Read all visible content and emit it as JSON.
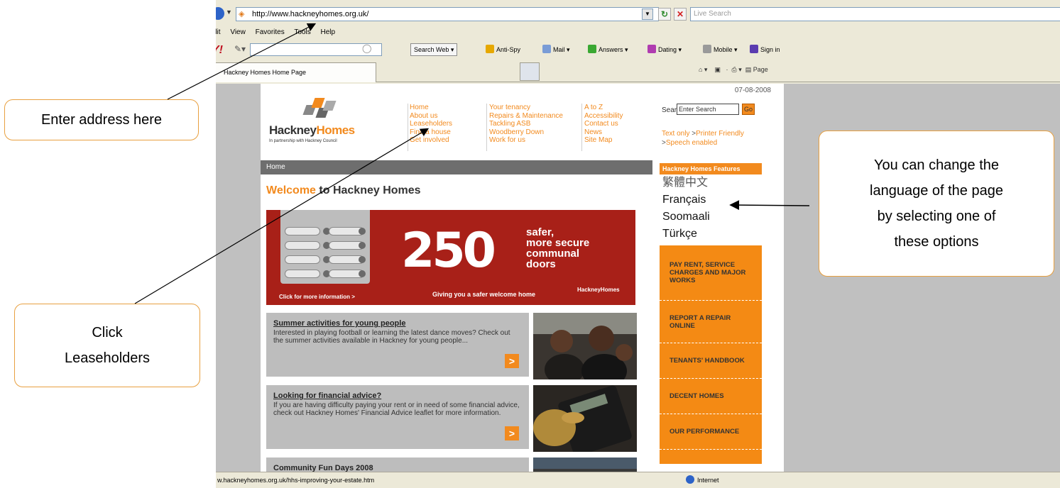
{
  "browser": {
    "address_url": "http://www.hackneyhomes.org.uk/",
    "live_search_placeholder": "Live Search",
    "menu": [
      "dit",
      "View",
      "Favorites",
      "Tools",
      "Help"
    ],
    "toolbar": {
      "search_web_label": "Search Web",
      "anti_spy_label": "Anti-Spy",
      "mail_label": "Mail",
      "answers_label": "Answers",
      "dating_label": "Dating",
      "mobile_label": "Mobile",
      "sign_in_label": "Sign in"
    },
    "tab_title": "Hackney Homes Home Page",
    "command_page_label": "Page",
    "status_url": "w.hackneyhomes.org.uk/hhs-improving-your-estate.htm",
    "status_zone": "Internet"
  },
  "site": {
    "date": "07-08-2008",
    "logo_name_part1": "Hackney",
    "logo_name_part2": "Homes",
    "logo_tagline": "In partnership with Hackney Council",
    "nav": [
      [
        "Home",
        "About us",
        "Leaseholders",
        "Find a house",
        "Get involved"
      ],
      [
        "Your tenancy",
        "Repairs & Maintenance",
        "Tackling ASB",
        "Woodberry Down",
        "Work for us"
      ],
      [
        "A to Z",
        "Accessibility",
        "Contact us",
        "News",
        "Site Map"
      ]
    ],
    "search_label": "Search:",
    "search_placeholder": "Enter Search",
    "search_go": "Go",
    "util_text_only": "Text only",
    "util_printer": "Printer Friendly",
    "util_speech": "Speech enabled",
    "breadcrumb": "Home",
    "welcome_part1": "Welcome",
    "welcome_part2": " to Hackney Homes",
    "banner": {
      "big_number": "250",
      "headline_lines": [
        "safer,",
        "more secure",
        "communal",
        "doors"
      ],
      "click_text": "Click for more information >",
      "tagline": "Giving you a safer welcome home",
      "logo_text": "HackneyHomes"
    },
    "news": [
      {
        "title": "Summer activities for young people",
        "body": "Interested in playing football or learning the latest dance moves? Check out the summer activities available in Hackney for young people..."
      },
      {
        "title": "Looking for financial advice?",
        "body": "If you are having difficulty paying your rent or in need of some financial advice, check out Hackney Homes' Financial Advice leaflet for more information."
      },
      {
        "title": "Community Fun Days 2008",
        "body": ""
      }
    ],
    "features_heading": "Hackney Homes Features",
    "languages": [
      "繁體中文",
      "Français",
      "Soomaali",
      "Türkçe"
    ],
    "orange_links": [
      "PAY RENT, SERVICE CHARGES AND MAJOR WORKS",
      "REPORT A REPAIR ONLINE",
      "TENANTS' HANDBOOK",
      "DECENT HOMES",
      "OUR PERFORMANCE"
    ]
  },
  "callouts": {
    "address": "Enter address here",
    "leaseholders_line1": "Click",
    "leaseholders_line2": "Leaseholders",
    "language_lines": [
      "You can change the",
      "language of the page",
      "by selecting one of",
      "these options"
    ]
  },
  "colors": {
    "brand_orange": "#f28a1e",
    "banner_red": "#a82018",
    "callout_border": "#e8a040"
  }
}
